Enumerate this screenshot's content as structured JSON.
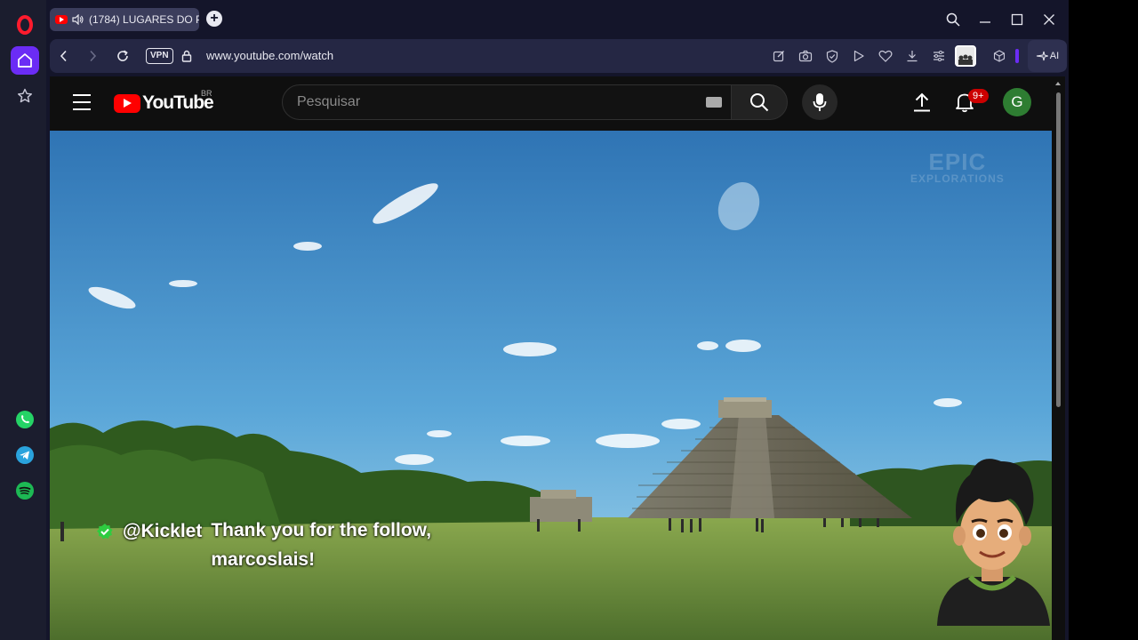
{
  "browser": {
    "tab": {
      "title": "(1784) LUGARES DO P"
    },
    "new_tab_label": "+",
    "address_bar": {
      "vpn_label": "VPN",
      "url": "www.youtube.com/watch",
      "ai_label": "AI"
    }
  },
  "youtube": {
    "logo_text": "YouTube",
    "region": "BR",
    "search_placeholder": "Pesquisar",
    "notifications_badge": "9+",
    "avatar_letter": "G"
  },
  "video": {
    "watermark_line1": "EPIC",
    "watermark_line2": "EXPLORATIONS",
    "alert": {
      "username": "@Kicklet",
      "message": "Thank you for the follow, marcoslais!"
    }
  },
  "colors": {
    "opera_red": "#ff1b2d",
    "accent_purple": "#6b2cf5",
    "yt_red": "#ff0000",
    "badge_red": "#cc0000",
    "avatar_green": "#2e7d32"
  }
}
